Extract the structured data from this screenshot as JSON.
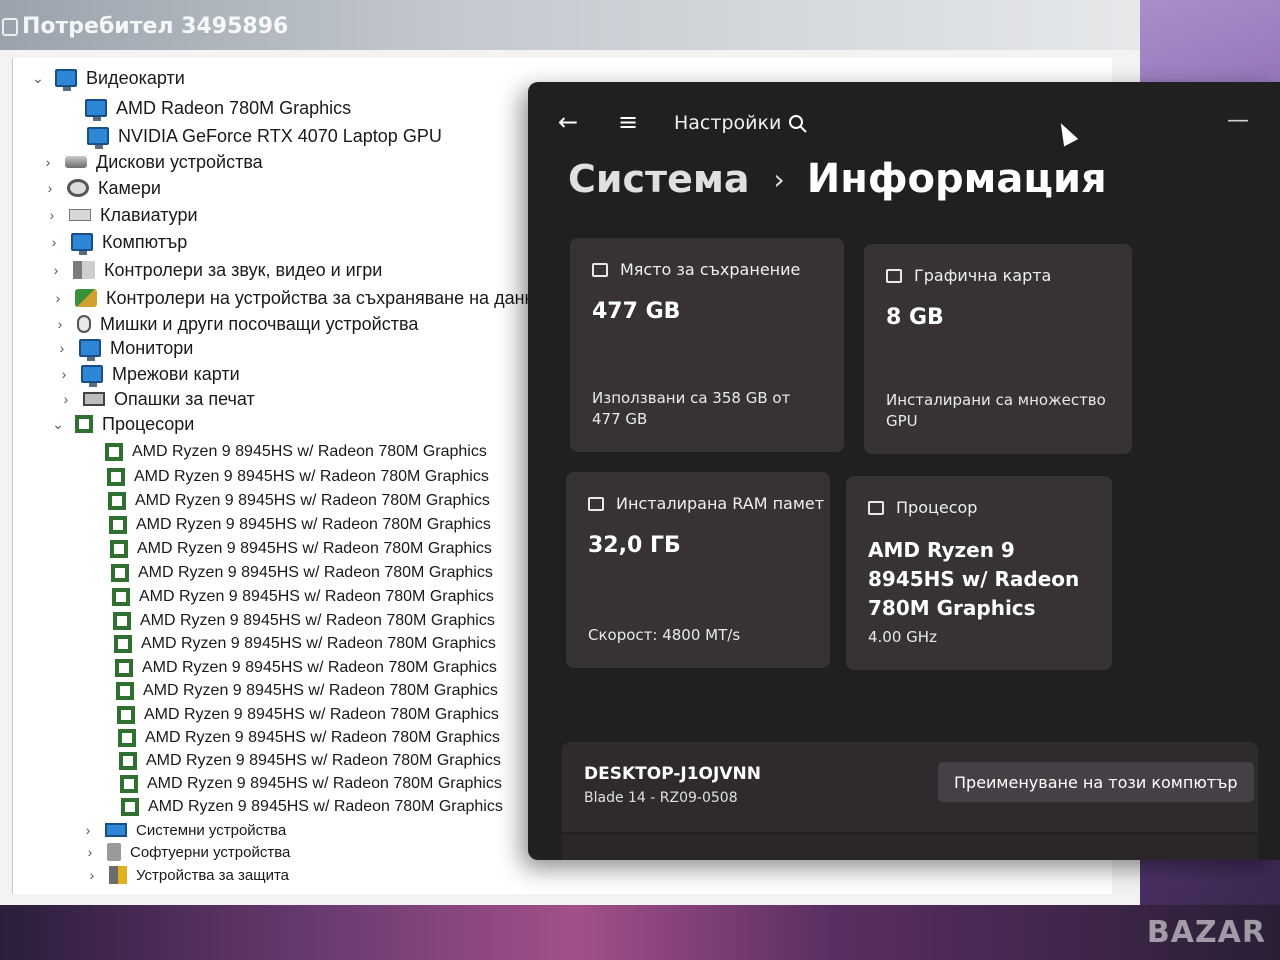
{
  "device_manager": {
    "user_title": "Потребител 3495896",
    "tree": [
      {
        "label": "Видеокарти",
        "chevron": "⌄",
        "icon": "display-adapter-icon"
      },
      {
        "label": "AMD Radeon 780M Graphics",
        "chevron": "",
        "icon": "display-adapter-icon"
      },
      {
        "label": "NVIDIA GeForce RTX 4070 Laptop GPU",
        "chevron": "",
        "icon": "display-adapter-icon"
      },
      {
        "label": "Дискови устройства",
        "chevron": "›",
        "icon": "disk-drive-icon"
      },
      {
        "label": "Камери",
        "chevron": "›",
        "icon": "camera-icon"
      },
      {
        "label": "Клавиатури",
        "chevron": "›",
        "icon": "keyboard-icon"
      },
      {
        "label": "Компютър",
        "chevron": "›",
        "icon": "computer-icon"
      },
      {
        "label": "Контролери за звук, видео и игри",
        "chevron": "›",
        "icon": "sound-icon"
      },
      {
        "label": "Контролери на устройства за съхраняване на данни",
        "chevron": "›",
        "icon": "storage-controller-icon"
      },
      {
        "label": "Мишки и други посочващи устройства",
        "chevron": "›",
        "icon": "mouse-icon"
      },
      {
        "label": "Монитори",
        "chevron": "›",
        "icon": "monitor-icon"
      },
      {
        "label": "Мрежови карти",
        "chevron": "›",
        "icon": "network-adapter-icon"
      },
      {
        "label": "Опашки за печат",
        "chevron": "›",
        "icon": "printer-icon"
      },
      {
        "label": "Процесори",
        "chevron": "⌄",
        "icon": "processor-icon"
      },
      {
        "label": "AMD Ryzen 9 8945HS w/ Radeon 780M Graphics",
        "chevron": "",
        "icon": "processor-icon"
      },
      {
        "label": "AMD Ryzen 9 8945HS w/ Radeon 780M Graphics",
        "chevron": "",
        "icon": "processor-icon"
      },
      {
        "label": "AMD Ryzen 9 8945HS w/ Radeon 780M Graphics",
        "chevron": "",
        "icon": "processor-icon"
      },
      {
        "label": "AMD Ryzen 9 8945HS w/ Radeon 780M Graphics",
        "chevron": "",
        "icon": "processor-icon"
      },
      {
        "label": "AMD Ryzen 9 8945HS w/ Radeon 780M Graphics",
        "chevron": "",
        "icon": "processor-icon"
      },
      {
        "label": "AMD Ryzen 9 8945HS w/ Radeon 780M Graphics",
        "chevron": "",
        "icon": "processor-icon"
      },
      {
        "label": "AMD Ryzen 9 8945HS w/ Radeon 780M Graphics",
        "chevron": "",
        "icon": "processor-icon"
      },
      {
        "label": "AMD Ryzen 9 8945HS w/ Radeon 780M Graphics",
        "chevron": "",
        "icon": "processor-icon"
      },
      {
        "label": "AMD Ryzen 9 8945HS w/ Radeon 780M Graphics",
        "chevron": "",
        "icon": "processor-icon"
      },
      {
        "label": "AMD Ryzen 9 8945HS w/ Radeon 780M Graphics",
        "chevron": "",
        "icon": "processor-icon"
      },
      {
        "label": "AMD Ryzen 9 8945HS w/ Radeon 780M Graphics",
        "chevron": "",
        "icon": "processor-icon"
      },
      {
        "label": "AMD Ryzen 9 8945HS w/ Radeon 780M Graphics",
        "chevron": "",
        "icon": "processor-icon"
      },
      {
        "label": "AMD Ryzen 9 8945HS w/ Radeon 780M Graphics",
        "chevron": "",
        "icon": "processor-icon"
      },
      {
        "label": "AMD Ryzen 9 8945HS w/ Radeon 780M Graphics",
        "chevron": "",
        "icon": "processor-icon"
      },
      {
        "label": "AMD Ryzen 9 8945HS w/ Radeon 780M Graphics",
        "chevron": "",
        "icon": "processor-icon"
      },
      {
        "label": "AMD Ryzen 9 8945HS w/ Radeon 780M Graphics",
        "chevron": "",
        "icon": "processor-icon"
      },
      {
        "label": "Системни устройства",
        "chevron": "›",
        "icon": "system-devices-icon"
      },
      {
        "label": "Софтуерни устройства",
        "chevron": "›",
        "icon": "software-devices-icon"
      },
      {
        "label": "Устройства за защита",
        "chevron": "›",
        "icon": "security-devices-icon"
      }
    ]
  },
  "settings": {
    "app_title": "Настройки",
    "icons": {
      "back": "back-arrow-icon",
      "menu": "hamburger-menu-icon",
      "search": "search-icon",
      "minimize": "minimize-icon"
    },
    "breadcrumb": {
      "parent": "Система",
      "separator": "›",
      "current": "Информация"
    },
    "cards": {
      "storage": {
        "title": "Място за съхранение",
        "value": "477 GB",
        "sub": "Използвани са 358 GB от 477 GB",
        "icon": "storage-icon"
      },
      "gpu": {
        "title": "Графична карта",
        "value": "8 GB",
        "sub": "Инсталирани са множество GPU",
        "icon": "graphics-card-icon"
      },
      "ram": {
        "title": "Инсталирана RAM памет",
        "value": "32,0 ГБ",
        "sub": "Скорост: 4800 MT/s",
        "icon": "ram-icon"
      },
      "cpu": {
        "title": "Процесор",
        "value": "AMD Ryzen 9 8945HS w/ Radeon 780M Graphics",
        "sub": "4.00 GHz",
        "icon": "processor-icon"
      }
    },
    "device": {
      "name": "DESKTOP-J1OJVNN",
      "model": "Blade 14 - RZ09-0508",
      "rename_label": "Преименуване на този компютър"
    }
  },
  "watermark": "BAZAR"
}
